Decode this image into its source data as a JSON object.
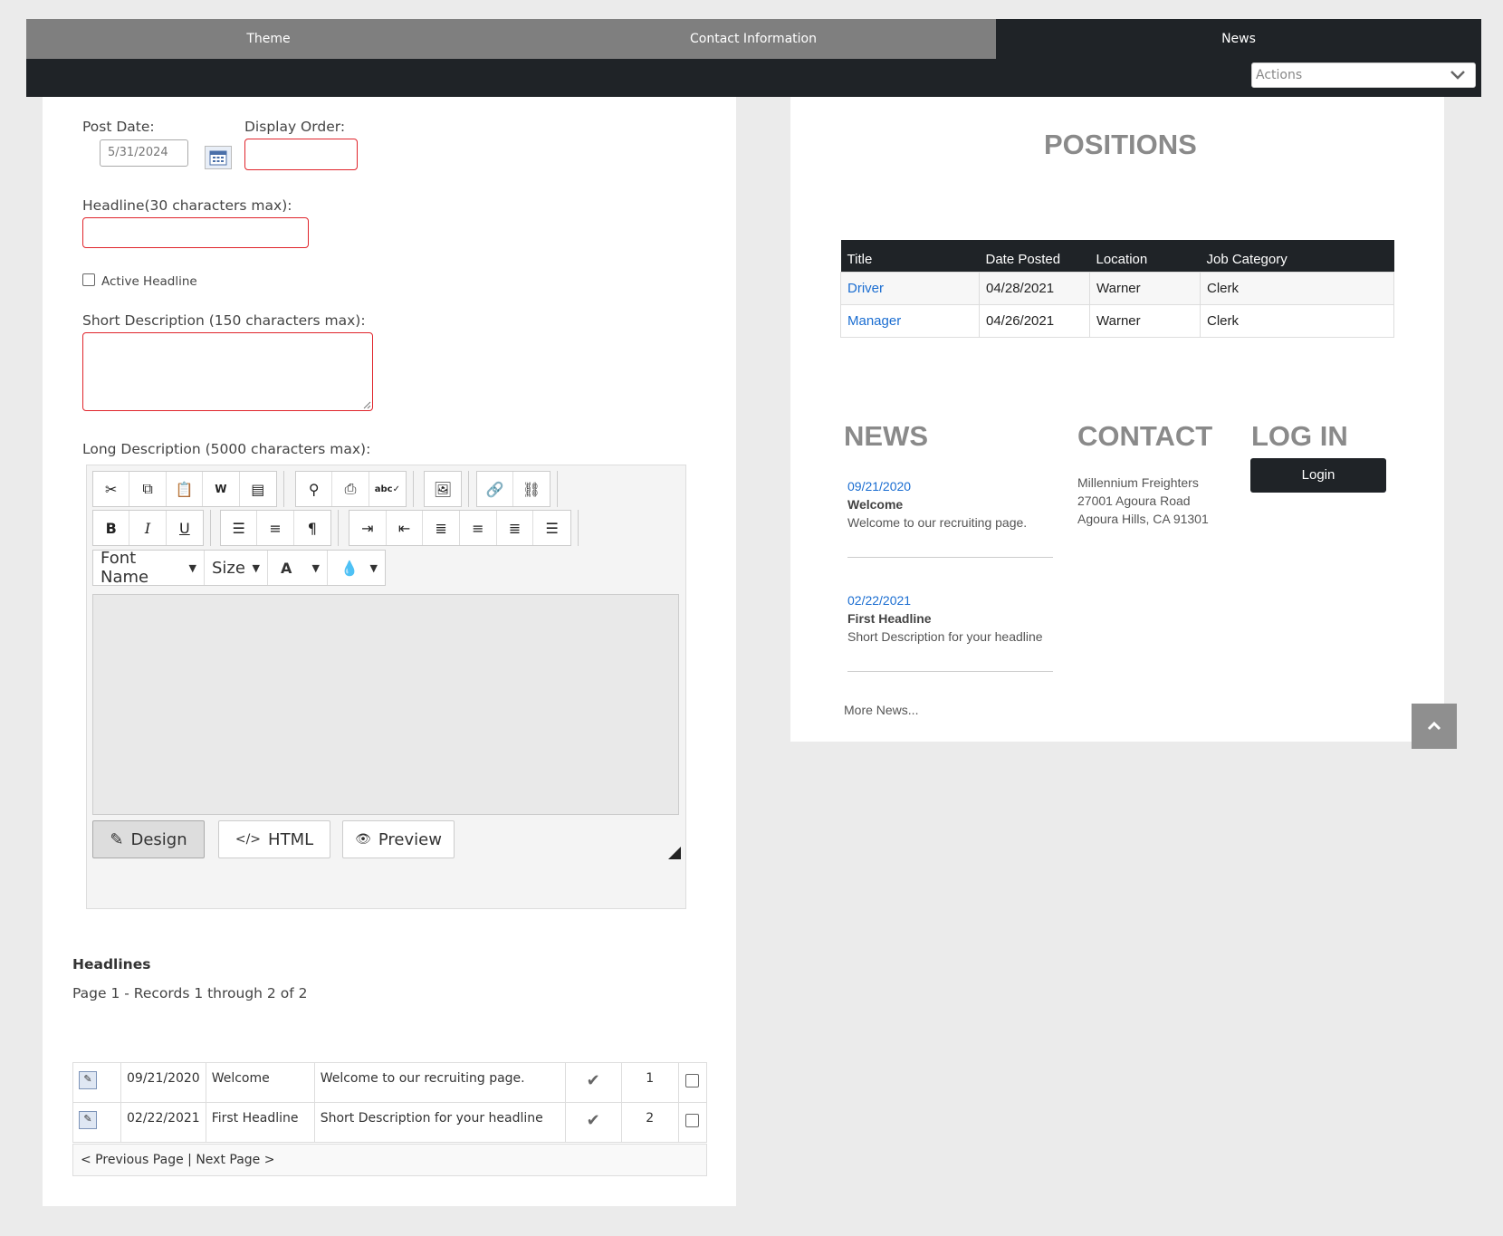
{
  "tabs": [
    {
      "label": "Theme"
    },
    {
      "label": "Contact Information"
    },
    {
      "label": "News"
    }
  ],
  "actions": {
    "placeholder": "Actions"
  },
  "form": {
    "post_date_label": "Post Date:",
    "post_date_value": "5/31/2024",
    "display_order_label": "Display Order:",
    "headline_label": "Headline(30 characters max):",
    "active_headline_label": "Active Headline",
    "short_desc_label": "Short Description (150 characters max):",
    "long_desc_label": "Long Description (5000 characters max):"
  },
  "editor": {
    "font_name": "Font Name",
    "size": "Size",
    "font_color": "A",
    "modes": {
      "design": "Design",
      "html": "HTML",
      "preview": "Preview"
    }
  },
  "headlines": {
    "title": "Headlines",
    "summary": "Page 1 - Records 1 through 2 of 2",
    "rows": [
      {
        "date": "09/21/2020",
        "headline": "Welcome",
        "description": "Welcome to our recruiting page.",
        "order": "1"
      },
      {
        "date": "02/22/2021",
        "headline": "First Headline",
        "description": "Short Description for your headline",
        "order": "2"
      }
    ],
    "prev": "< Previous Page",
    "divider": "|",
    "next": "Next Page >"
  },
  "positions": {
    "title": "POSITIONS",
    "headers": [
      "Title",
      "Date Posted",
      "Location",
      "Job Category"
    ],
    "rows": [
      {
        "title": "Driver",
        "date": "04/28/2021",
        "location": "Warner",
        "category": "Clerk"
      },
      {
        "title": "Manager",
        "date": "04/26/2021",
        "location": "Warner",
        "category": "Clerk"
      }
    ]
  },
  "news": {
    "title": "NEWS",
    "items": [
      {
        "date": "09/21/2020",
        "headline": "Welcome",
        "description": "Welcome to our recruiting page."
      },
      {
        "date": "02/22/2021",
        "headline": "First Headline",
        "description": "Short Description for your headline"
      }
    ],
    "more": "More News..."
  },
  "contact": {
    "title": "CONTACT",
    "lines": [
      "Millennium Freighters",
      "27001 Agoura Road",
      "Agoura Hills, CA 91301"
    ]
  },
  "login": {
    "title": "LOG IN",
    "button": "Login"
  },
  "colors": {
    "dark": "#1f2327",
    "tab_inactive": "#7f7f7f",
    "required_border": "#e0242b",
    "link": "#1a6dd1",
    "heading": "#8a8a8a"
  }
}
